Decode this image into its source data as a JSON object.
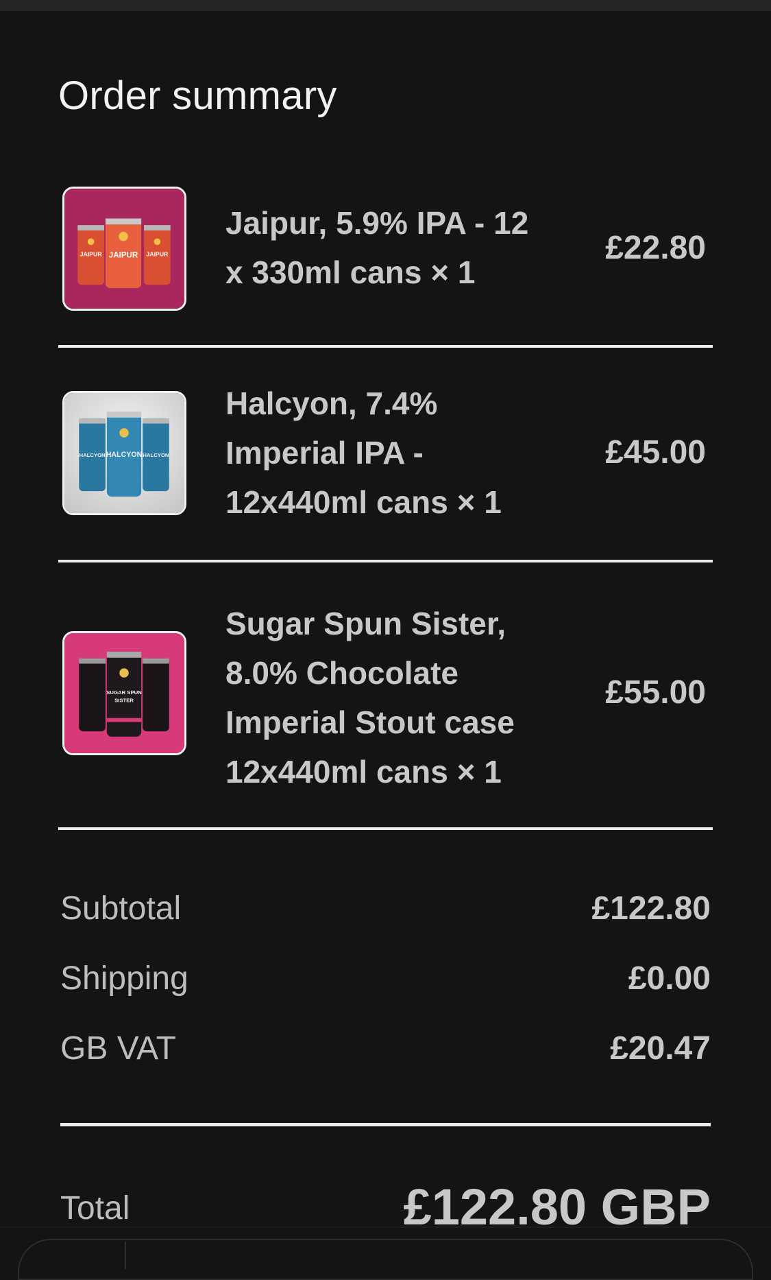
{
  "title": "Order summary",
  "items": [
    {
      "name": "Jaipur, 5.9% IPA - 12 x 330ml cans × 1",
      "price": "£22.80",
      "image": {
        "icon": "beer-cans-jaipur",
        "label": "JAIPUR",
        "background": "#a8285e",
        "can": "#e65a3a"
      }
    },
    {
      "name": "Halcyon, 7.4% Imperial IPA - 12x440ml cans × 1",
      "price": "£45.00",
      "image": {
        "icon": "beer-cans-halcyon",
        "label": "HALCYON",
        "background": "#d9d9d9",
        "can": "#2f7fa8"
      }
    },
    {
      "name": "Sugar Spun Sister, 8.0% Chocolate Imperial Stout case 12x440ml cans × 1",
      "price": "£55.00",
      "image": {
        "icon": "beer-cans-sugar-spun-sister",
        "label": "SUGAR SPUN SISTER",
        "background": "#d63a78",
        "can": "#1a1418"
      }
    }
  ],
  "summary": [
    {
      "label": "Subtotal",
      "value": "£122.80"
    },
    {
      "label": "Shipping",
      "value": "£0.00"
    },
    {
      "label": "GB VAT",
      "value": "£20.47"
    }
  ],
  "total": {
    "label": "Total",
    "value": "£122.80 GBP"
  },
  "colors": {
    "background": "#141414",
    "text": "#c8c8c8",
    "divider": "#ececec"
  }
}
